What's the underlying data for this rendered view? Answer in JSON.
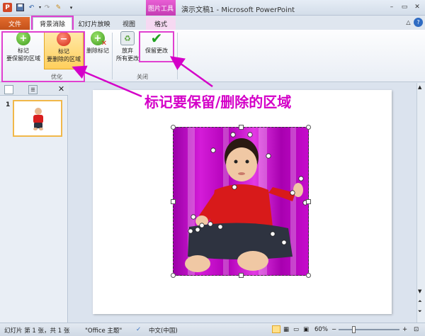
{
  "titlebar": {
    "app_icon": "P",
    "document_title": "演示文稿1 - Microsoft PowerPoint",
    "context_tab_title": "图片工具",
    "qat": {
      "save_icon": "save-icon",
      "undo_icon": "undo-icon",
      "redo_icon": "redo-icon",
      "customize_icon": "customize-icon"
    },
    "window_buttons": {
      "minimize": "–",
      "restore": "▭",
      "close": "✕"
    }
  },
  "tabs": {
    "file": "文件",
    "background_removal": "背景消除",
    "slideshow": "幻灯片放映",
    "view": "视图",
    "format": "格式"
  },
  "ribbon": {
    "buttons": {
      "mark_keep": {
        "line1": "标记",
        "line2": "要保留的区域"
      },
      "mark_remove": {
        "line1": "标记",
        "line2": "要删除的区域"
      },
      "delete_mark": {
        "line1": "删除标记"
      },
      "discard": {
        "line1": "放弃",
        "line2": "所有更改"
      },
      "keep_changes": {
        "line1": "保留更改"
      }
    },
    "groups": {
      "refine": "优化",
      "close": "关闭"
    }
  },
  "left_panel": {
    "slide_number": "1"
  },
  "annotation": {
    "text": "标记要保留/删除的区域"
  },
  "statusbar": {
    "slide_info": "幻灯片 第 1 张，共 1 张",
    "theme": "\"Office 主题\"",
    "language": "中文(中国)",
    "zoom": "60%",
    "zoom_minus": "−",
    "zoom_plus": "+"
  },
  "colors": {
    "highlight": "#e040d0",
    "background_removal_magenta": "#c010c8",
    "file_tab": "#d75b23",
    "context_tab": "#d64ac6"
  }
}
